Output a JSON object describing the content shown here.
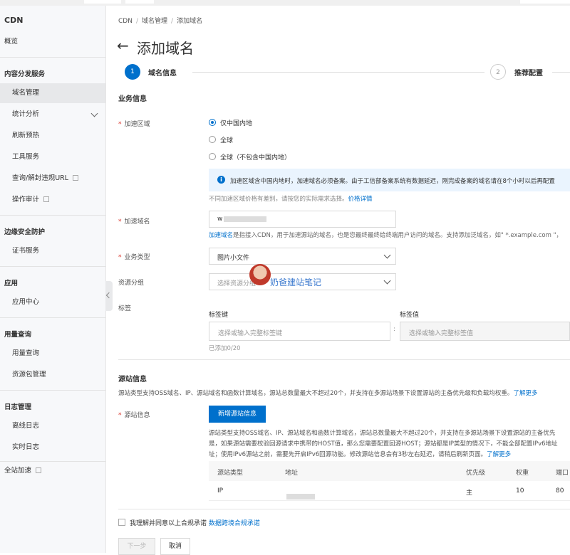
{
  "sidebar": {
    "title": "CDN",
    "overview": "概览",
    "groups": {
      "content": "内容分发服务",
      "edge": "边缘安全防护",
      "apps": "应用",
      "usage": "用量查询",
      "logs": "日志管理"
    },
    "items": {
      "domain_mgmt": "域名管理",
      "stats": "统计分析",
      "refresh": "刷新预热",
      "tools": "工具服务",
      "query_url": "查询/解封违规URL",
      "audit": "操作审计",
      "cert": "证书服务",
      "app_center": "应用中心",
      "usage_query": "用量查询",
      "package_mgmt": "资源包管理",
      "offline_logs": "离线日志",
      "realtime_logs": "实时日志",
      "dcdn": "全站加速"
    }
  },
  "breadcrumb": {
    "a": "CDN",
    "b": "域名管理",
    "c": "添加域名",
    "sep": "/"
  },
  "page": {
    "back": "←",
    "title": "添加域名"
  },
  "steps": {
    "s1_num": "1",
    "s1_label": "域名信息",
    "s2_num": "2",
    "s2_label": "推荐配置"
  },
  "business": {
    "section": "业务信息",
    "region_label": "加速区域",
    "region_options": [
      "仅中国内地",
      "全球",
      "全球（不包含中国内地）"
    ],
    "notice": "加速区域含中国内地时，加速域名必须备案。由于工信部备案系统有数据延迟，刚完成备案的域名请在8个小时以后再配置",
    "price_hint": "不同加速区域价格有差别，请按您的实际需求选择。",
    "price_link": "价格详情",
    "domain_label": "加速域名",
    "domain_value": "w",
    "domain_hint_link": "加速域名",
    "domain_hint": "是指接入CDN，用于加速源站的域名，也是您最终最终给终端用户访问的域名。支持添加泛域名，如\" *.example.com \"，",
    "type_label": "业务类型",
    "type_value": "图片小文件",
    "group_label": "资源分组",
    "group_placeholder": "选择资源分组",
    "watermark": "奶爸建站笔记",
    "tag_label": "标签",
    "tag_key_label": "标签键",
    "tag_val_label": "标签值",
    "tag_key_placeholder": "选择或输入完整标签键",
    "tag_val_placeholder": "选择或输入完整标签值",
    "tag_count": "已添加0/20",
    "colon": ":"
  },
  "origin": {
    "section": "源站信息",
    "desc": "源站类型支持OSS域名、IP、源站域名和函数计算域名，源站总数量最大不超过20个，并支持在多源站场景下设置源站的主备优先级和负载均权重。",
    "desc_link": "了解更多",
    "label": "源站信息",
    "add_button": "新增源站信息",
    "para1": "源站类型支持OSS域名、IP、源站域名和函数计算域名，源站总数量最大不超过20个，并支持在多源站场景下设置源站的主备优先",
    "para2": "是，如果源站需要校验回源请求中携带的HOST值，那么您需要配置回源HOST；源站都是IP类型的情况下，不能全部配置IPv6地址",
    "para3": "址；使用IPv6源站之前，需要先开启IPv6回源功能。修改源站信息会有3秒左右延迟，请稍后刷新页面。",
    "para_link": "了解更多",
    "table": {
      "headers": [
        "源站类型",
        "地址",
        "优先级",
        "权重",
        "端口"
      ],
      "row": [
        "IP",
        "",
        "主",
        "10",
        "80"
      ]
    }
  },
  "footer": {
    "agree": "我理解并同意以上合规承诺",
    "agree_link": "数据跨境合规承诺",
    "next": "下一步",
    "cancel": "取消"
  }
}
